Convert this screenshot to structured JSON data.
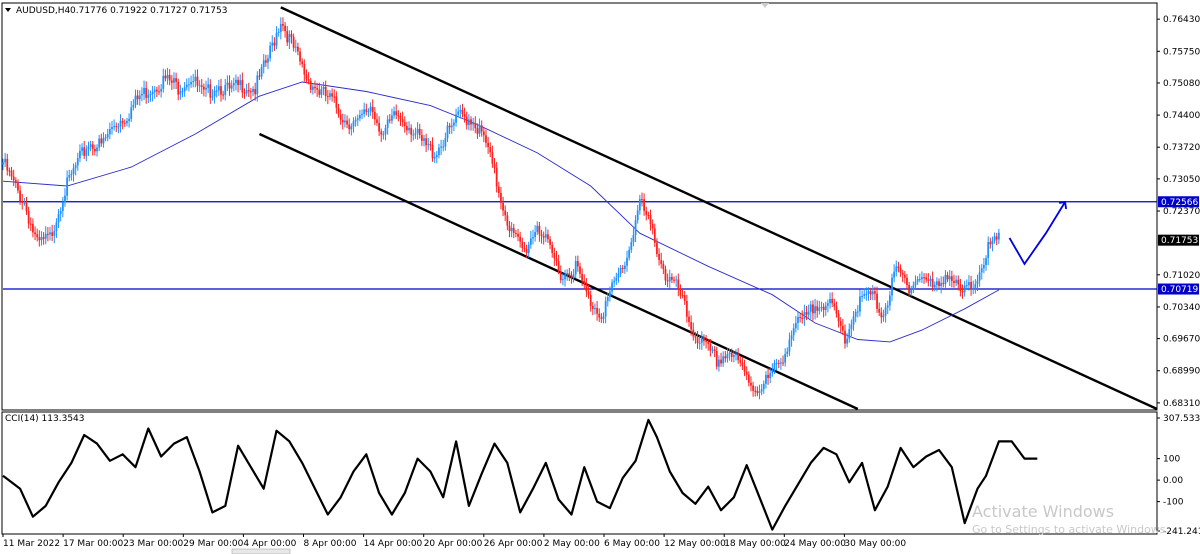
{
  "header": {
    "symbol": "AUDUSD,H4",
    "ohlc": "0.71776 0.71922 0.71727 0.71753",
    "menu_icon": "triangle-down-icon"
  },
  "indicator": {
    "label": "CCI(14) 113.3543"
  },
  "watermark": {
    "line1": "Activate Windows",
    "line2": "Go to Settings to activate Windows."
  },
  "colors": {
    "bull": "#1e90ff",
    "bear": "#ff2020",
    "ma": "#2a2ad0",
    "level": "#0000c8",
    "arrow": "#0000e0",
    "channel": "#000000",
    "current_flag": "#000000"
  },
  "chart_data": [
    {
      "type": "candlestick",
      "symbol": "AUDUSD",
      "timeframe": "H4",
      "y_ticks": [
        "0.76430",
        "0.75750",
        "0.75080",
        "0.74400",
        "0.73720",
        "0.73050",
        "0.72370",
        "0.71020",
        "0.70340",
        "0.69670",
        "0.68990",
        "0.68310"
      ],
      "y_tick_values": [
        0.7643,
        0.7575,
        0.7508,
        0.744,
        0.7372,
        0.7305,
        0.7237,
        0.7102,
        0.7034,
        0.6967,
        0.6899,
        0.6831
      ],
      "x_ticks": [
        "11 Mar 2022",
        "17 Mar 00:00",
        "23 Mar 00:00",
        "29 Mar 00:00",
        "4 Apr 00:00",
        "8 Apr 00:00",
        "14 Apr 00:00",
        "20 Apr 00:00",
        "26 Apr 00:00",
        "2 May 00:00",
        "6 May 00:00",
        "12 May 00:00",
        "18 May 00:00",
        "24 May 00:00",
        "30 May 00:00"
      ],
      "ylim": [
        0.6818,
        0.7673
      ],
      "current_price": {
        "label": "0.71753",
        "value": 0.71753
      },
      "levels": [
        {
          "label": "0.72566",
          "value": 0.72566
        },
        {
          "label": "0.70719",
          "value": 0.70719
        }
      ],
      "close_path": [
        [
          0,
          0.734
        ],
        [
          6,
          0.7285
        ],
        [
          10,
          0.7255
        ],
        [
          16,
          0.7165
        ],
        [
          22,
          0.718
        ],
        [
          28,
          0.727
        ],
        [
          34,
          0.733
        ],
        [
          40,
          0.738
        ],
        [
          46,
          0.7375
        ],
        [
          52,
          0.742
        ],
        [
          58,
          0.744
        ],
        [
          64,
          0.748
        ],
        [
          70,
          0.75
        ],
        [
          76,
          0.7515
        ],
        [
          82,
          0.75
        ],
        [
          88,
          0.752
        ],
        [
          94,
          0.748
        ],
        [
          100,
          0.7505
        ],
        [
          106,
          0.749
        ],
        [
          112,
          0.7505
        ],
        [
          118,
          0.7495
        ],
        [
          124,
          0.756
        ],
        [
          130,
          0.7643
        ],
        [
          136,
          0.758
        ],
        [
          142,
          0.752
        ],
        [
          148,
          0.749
        ],
        [
          154,
          0.747
        ],
        [
          160,
          0.743
        ],
        [
          166,
          0.742
        ],
        [
          172,
          0.746
        ],
        [
          178,
          0.74
        ],
        [
          184,
          0.744
        ],
        [
          190,
          0.742
        ],
        [
          196,
          0.738
        ],
        [
          202,
          0.736
        ],
        [
          208,
          0.74
        ],
        [
          214,
          0.744
        ],
        [
          220,
          0.743
        ],
        [
          226,
          0.738
        ],
        [
          232,
          0.728
        ],
        [
          238,
          0.719
        ],
        [
          244,
          0.715
        ],
        [
          250,
          0.721
        ],
        [
          256,
          0.715
        ],
        [
          262,
          0.71
        ],
        [
          268,
          0.712
        ],
        [
          274,
          0.705
        ],
        [
          280,
          0.702
        ],
        [
          286,
          0.708
        ],
        [
          292,
          0.714
        ],
        [
          298,
          0.7257
        ],
        [
          304,
          0.719
        ],
        [
          310,
          0.71
        ],
        [
          316,
          0.707
        ],
        [
          322,
          0.699
        ],
        [
          328,
          0.695
        ],
        [
          334,
          0.692
        ],
        [
          340,
          0.694
        ],
        [
          346,
          0.69
        ],
        [
          352,
          0.686
        ],
        [
          358,
          0.688
        ],
        [
          364,
          0.692
        ],
        [
          370,
          0.699
        ],
        [
          376,
          0.701
        ],
        [
          382,
          0.705
        ],
        [
          388,
          0.703
        ],
        [
          394,
          0.697
        ],
        [
          400,
          0.704
        ],
        [
          406,
          0.706
        ],
        [
          412,
          0.702
        ],
        [
          418,
          0.711
        ],
        [
          424,
          0.708
        ],
        [
          430,
          0.71
        ],
        [
          436,
          0.707
        ],
        [
          442,
          0.711
        ],
        [
          448,
          0.706
        ],
        [
          454,
          0.708
        ],
        [
          460,
          0.715
        ],
        [
          466,
          0.7175
        ]
      ],
      "moving_average_path": [
        [
          0,
          0.73
        ],
        [
          30,
          0.729
        ],
        [
          60,
          0.733
        ],
        [
          90,
          0.74
        ],
        [
          120,
          0.748
        ],
        [
          140,
          0.751
        ],
        [
          170,
          0.749
        ],
        [
          200,
          0.746
        ],
        [
          222,
          0.742
        ],
        [
          250,
          0.736
        ],
        [
          275,
          0.729
        ],
        [
          298,
          0.719
        ],
        [
          330,
          0.712
        ],
        [
          360,
          0.706
        ],
        [
          380,
          0.7
        ],
        [
          400,
          0.6965
        ],
        [
          415,
          0.696
        ],
        [
          430,
          0.6985
        ],
        [
          450,
          0.703
        ],
        [
          466,
          0.707
        ]
      ],
      "channel_lines": [
        {
          "from": [
            130,
            0.7668
          ],
          "to": [
            540,
            0.6818
          ]
        },
        {
          "from": [
            120,
            0.74
          ],
          "to": [
            400,
            0.6818
          ]
        }
      ],
      "projection_arrow": [
        [
          471,
          0.718
        ],
        [
          478,
          0.7125
        ],
        [
          488,
          0.719
        ],
        [
          497,
          0.7256
        ]
      ]
    },
    {
      "type": "line",
      "title": "CCI(14) 113.3543",
      "y_ticks": [
        "307.5333",
        "100",
        "0.00",
        "-100",
        "-241.2413"
      ],
      "y_tick_values": [
        307.5333,
        100,
        0,
        -100,
        -241.2413
      ],
      "ylim": [
        -241.2413,
        307.5333
      ],
      "series": [
        {
          "values": [
            [
              0,
              20
            ],
            [
              8,
              -40
            ],
            [
              14,
              -170
            ],
            [
              20,
              -120
            ],
            [
              26,
              -10
            ],
            [
              32,
              80
            ],
            [
              38,
              210
            ],
            [
              44,
              170
            ],
            [
              50,
              90
            ],
            [
              56,
              120
            ],
            [
              62,
              60
            ],
            [
              68,
              240
            ],
            [
              74,
              110
            ],
            [
              80,
              170
            ],
            [
              86,
              200
            ],
            [
              92,
              40
            ],
            [
              98,
              -150
            ],
            [
              104,
              -120
            ],
            [
              110,
              160
            ],
            [
              116,
              60
            ],
            [
              122,
              -40
            ],
            [
              128,
              230
            ],
            [
              134,
              180
            ],
            [
              140,
              80
            ],
            [
              146,
              -40
            ],
            [
              152,
              -160
            ],
            [
              158,
              -80
            ],
            [
              164,
              40
            ],
            [
              170,
              120
            ],
            [
              176,
              -60
            ],
            [
              182,
              -160
            ],
            [
              188,
              -60
            ],
            [
              194,
              100
            ],
            [
              200,
              40
            ],
            [
              206,
              -80
            ],
            [
              212,
              180
            ],
            [
              218,
              -120
            ],
            [
              224,
              30
            ],
            [
              230,
              170
            ],
            [
              236,
              80
            ],
            [
              242,
              -150
            ],
            [
              248,
              -40
            ],
            [
              254,
              80
            ],
            [
              260,
              -90
            ],
            [
              266,
              -160
            ],
            [
              272,
              60
            ],
            [
              278,
              -100
            ],
            [
              284,
              -130
            ],
            [
              290,
              10
            ],
            [
              296,
              90
            ],
            [
              302,
              280
            ],
            [
              306,
              200
            ],
            [
              312,
              40
            ],
            [
              318,
              -60
            ],
            [
              324,
              -110
            ],
            [
              330,
              -30
            ],
            [
              336,
              -140
            ],
            [
              342,
              -80
            ],
            [
              348,
              70
            ],
            [
              354,
              -80
            ],
            [
              360,
              -230
            ],
            [
              366,
              -120
            ],
            [
              372,
              -20
            ],
            [
              378,
              80
            ],
            [
              384,
              150
            ],
            [
              390,
              120
            ],
            [
              396,
              -10
            ],
            [
              402,
              80
            ],
            [
              408,
              -140
            ],
            [
              414,
              -30
            ],
            [
              420,
              150
            ],
            [
              426,
              60
            ],
            [
              432,
              110
            ],
            [
              438,
              140
            ],
            [
              444,
              60
            ],
            [
              450,
              -200
            ],
            [
              456,
              -40
            ],
            [
              460,
              20
            ],
            [
              466,
              180
            ],
            [
              472,
              180
            ],
            [
              478,
              100
            ],
            [
              484,
              100
            ]
          ]
        }
      ]
    }
  ]
}
